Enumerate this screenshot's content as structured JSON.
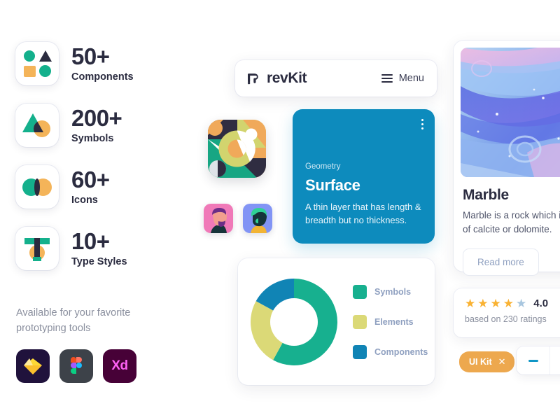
{
  "stats": [
    {
      "icon": "components-shapes-icon",
      "number": "50+",
      "label": "Components"
    },
    {
      "icon": "symbols-shapes-icon",
      "number": "200+",
      "label": "Symbols"
    },
    {
      "icon": "icons-circles-icon",
      "number": "60+",
      "label": "Icons"
    },
    {
      "icon": "type-styles-t-icon",
      "number": "10+",
      "label": "Type Styles"
    }
  ],
  "tools": {
    "caption": "Available for your favorite prototyping tools",
    "items": [
      {
        "name": "sketch-logo-icon",
        "label": ""
      },
      {
        "name": "figma-logo-icon",
        "label": ""
      },
      {
        "name": "adobe-xd-logo-icon",
        "label": "Xd"
      }
    ]
  },
  "navbar": {
    "logo_icon": "revkit-logo-icon",
    "brand": "revKit",
    "menu_icon": "hamburger-icon",
    "menu_label": "Menu"
  },
  "surface_card": {
    "kebab_icon": "more-vertical-icon",
    "eyebrow": "Geometry",
    "title": "Surface",
    "description": "A thin layer that has length & breadth but no thickness.",
    "background": "#0d8bbd"
  },
  "tile": {
    "name": "geometric-pattern-tile"
  },
  "avatars": [
    {
      "name": "avatar-pink"
    },
    {
      "name": "avatar-blue"
    }
  ],
  "chart_data": {
    "type": "pie",
    "title": "",
    "categories": [
      "Symbols",
      "Elements",
      "Components"
    ],
    "values": [
      58,
      25,
      17
    ],
    "colors": [
      "#17b08f",
      "#dbd977",
      "#1084b5"
    ],
    "legend_position": "right",
    "donut": true,
    "inner_radius_ratio": 0.56
  },
  "marble_card": {
    "image_name": "marble-texture-image",
    "title": "Marble",
    "description": "Marble is a rock which is of calcite or dolomite.",
    "button_label": "Read more"
  },
  "rating_card": {
    "stars_filled": 4,
    "stars_total": 5,
    "value": "4.0",
    "subtext": "based on 230 ratings",
    "star_color": "#f9b233",
    "star_empty_color": "#a8c6df"
  },
  "chip": {
    "label": "UI Kit",
    "close_icon": "close-icon",
    "color": "#eda84e"
  },
  "stepper": {
    "minus_label": "−",
    "value": ""
  }
}
